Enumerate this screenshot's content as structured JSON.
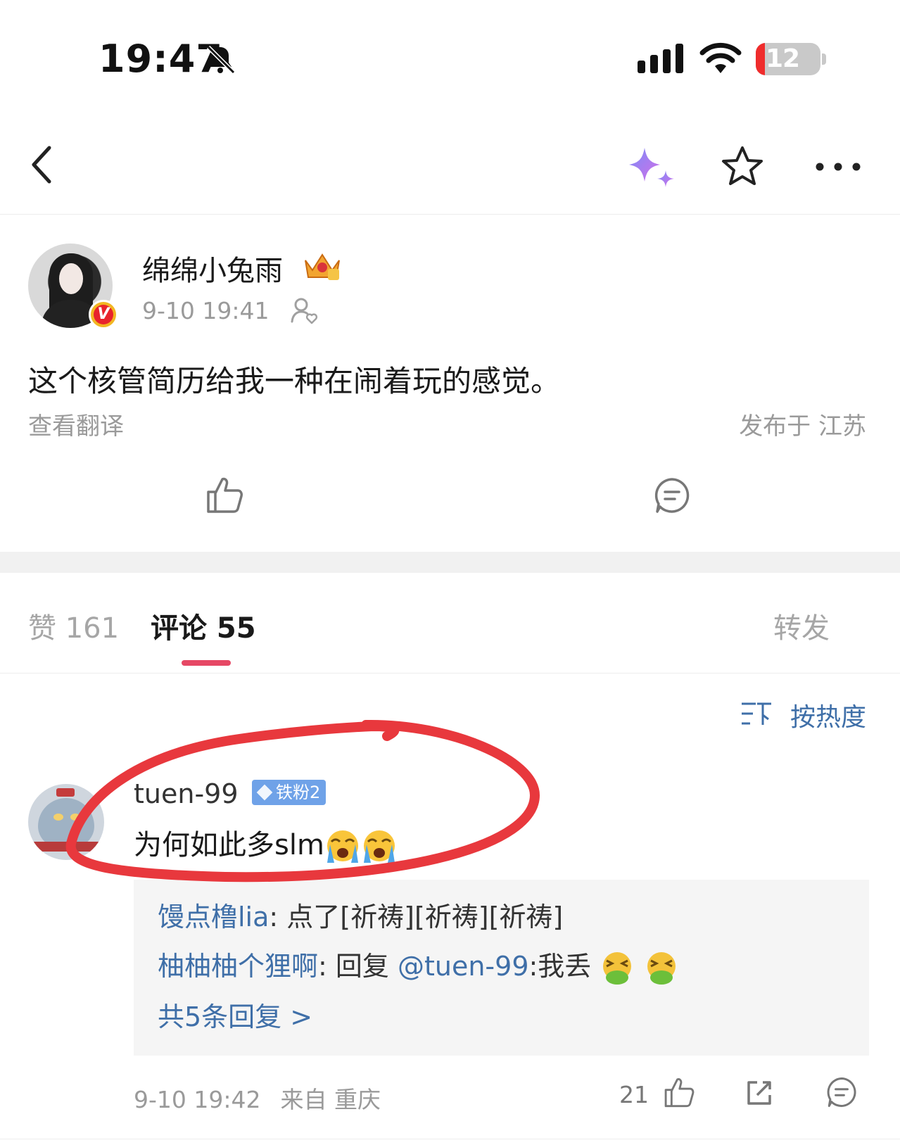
{
  "status_bar": {
    "time": "19:47",
    "battery": "12"
  },
  "post": {
    "author": "绵绵小兔雨",
    "time": "9-10 19:41",
    "text": "这个核管简历给我一种在闹着玩的感觉。",
    "translate_label": "查看翻译",
    "location": "发布于 江苏",
    "verified_badge": "V"
  },
  "tabs": [
    {
      "label": "赞 161"
    },
    {
      "label": "评论 55"
    },
    {
      "label": "转发"
    }
  ],
  "sort_label": "按热度",
  "comment": {
    "user": "tuen-99",
    "badge": "铁粉2",
    "text": "为何如此多slm",
    "replies": [
      {
        "user": "馒点橹lia",
        "text": ": 点了[祈祷][祈祷][祈祷]"
      },
      {
        "user": "柚柚柚个狸啊",
        "text_before": ": 回复 ",
        "mention": "@tuen-99",
        "text_after": ":我丢"
      }
    ],
    "more_replies": "共5条回复 >",
    "time": "9-10 19:42",
    "location": "来自 重庆",
    "likes": "21"
  },
  "colors": {
    "link_blue": "#3f6fa8",
    "accent_pink": "#e64865",
    "annotation_red": "#e8383d"
  }
}
